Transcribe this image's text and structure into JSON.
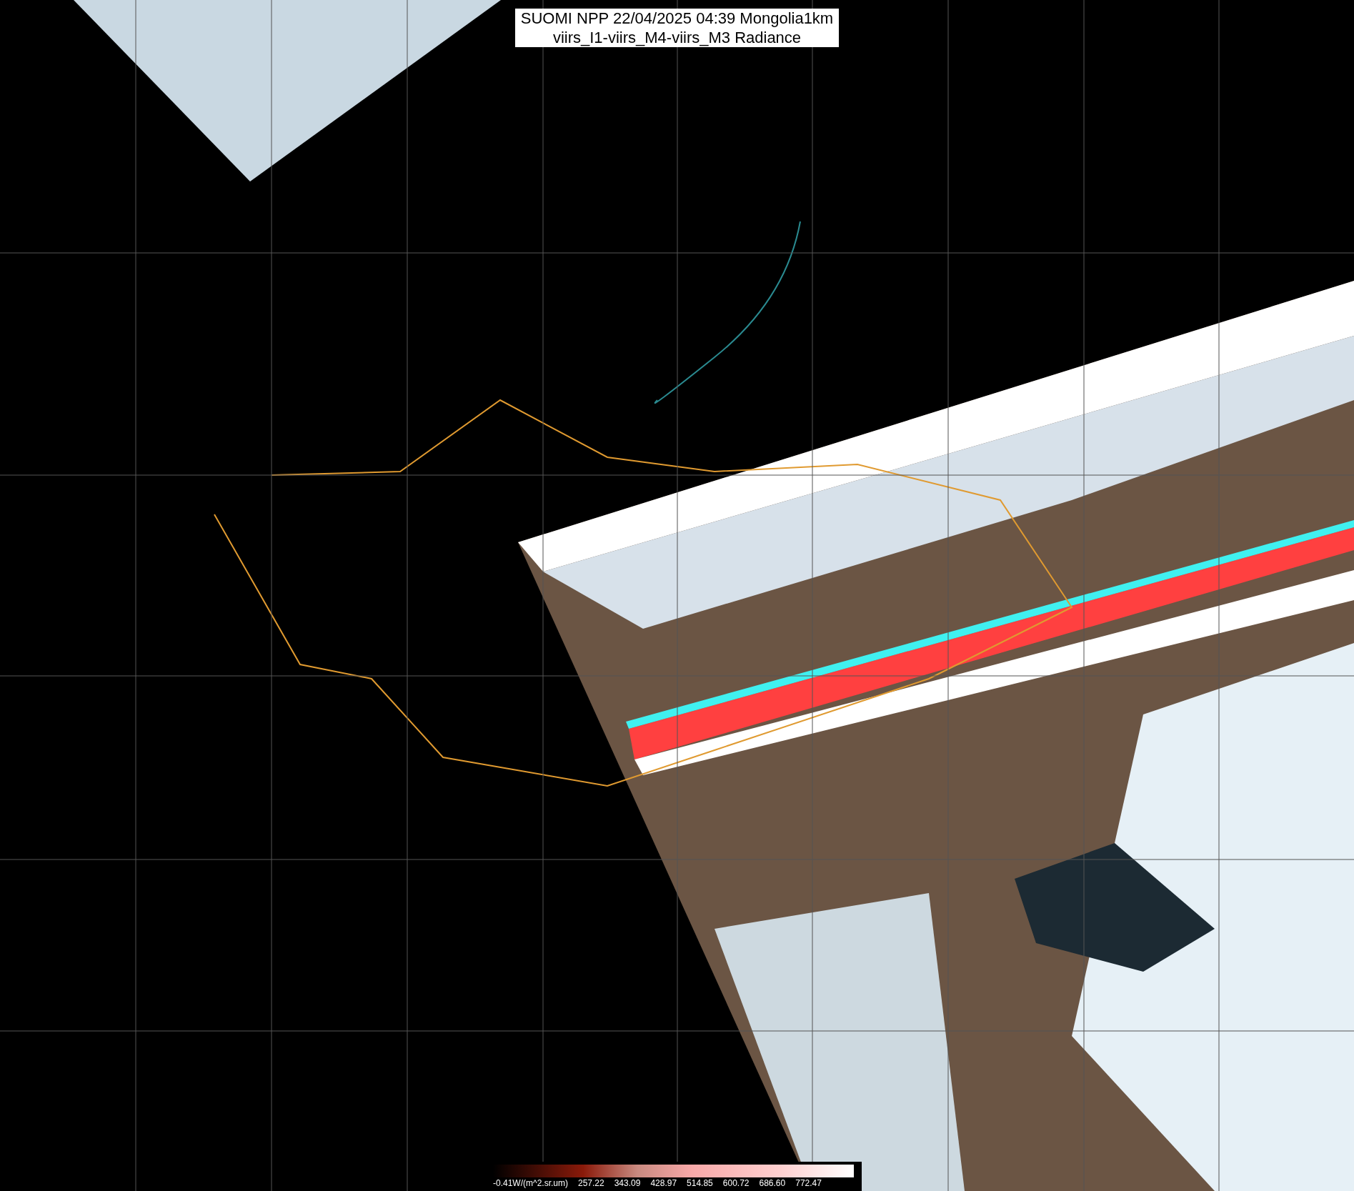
{
  "title": {
    "line_1": "SUOMI NPP 22/04/2025 04:39 Mongolia1km",
    "line_2": "viirs_I1-viirs_M4-viirs_M3 Radiance"
  },
  "colorbar": {
    "unit_label": "-0.41W/(m^2.sr.um)",
    "ticks": [
      "257.22",
      "343.09",
      "428.97",
      "514.85",
      "600.72",
      "686.60",
      "772.47"
    ]
  }
}
